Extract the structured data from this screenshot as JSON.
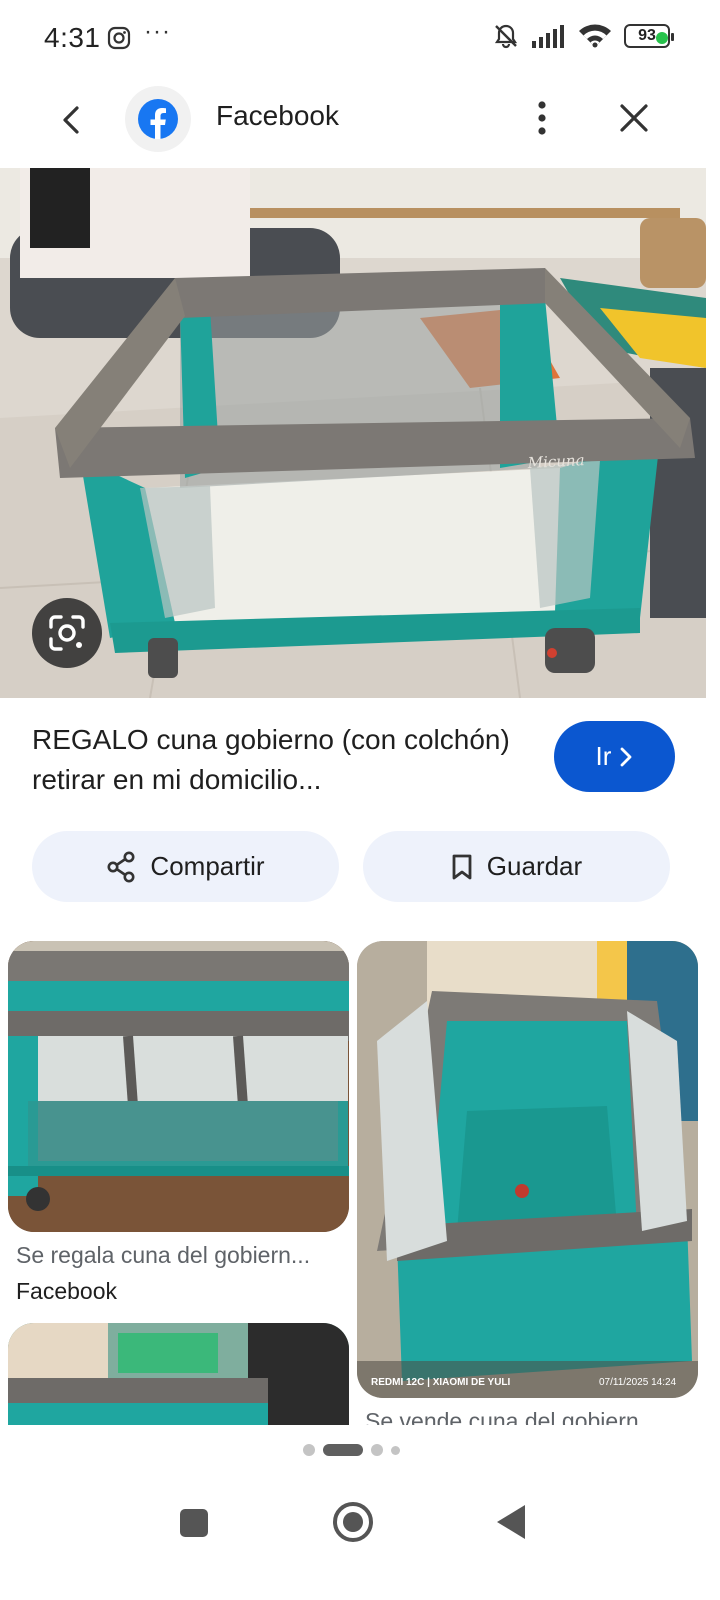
{
  "status_bar": {
    "time": "4:31",
    "battery": "93",
    "icons": [
      "instagram-icon",
      "more-dots-icon",
      "mute-icon",
      "signal-icon",
      "wifi-icon",
      "battery-icon"
    ]
  },
  "header": {
    "title": "Facebook",
    "back_icon": "chevron-left-icon",
    "more_icon": "more-vert-icon",
    "close_icon": "close-icon"
  },
  "result": {
    "title": "REGALO cuna gobierno (con colchón) retirar en mi domicilio...",
    "go_label": "Ir",
    "go_icon": "chevron-right-icon",
    "brand_accent": "#0b57d0"
  },
  "actions": {
    "share_label": "Compartir",
    "save_label": "Guardar"
  },
  "related": [
    {
      "caption": "Se regala cuna del gobiern...",
      "source": "Facebook"
    },
    {
      "caption": "Se vende cuna del gobiern",
      "watermark_left": "REDMI 12C | XIAOMI DE YULI",
      "watermark_right": "07/11/2025 14:24"
    },
    {
      "caption": ""
    }
  ],
  "main_image": {
    "brand_text": "Micuna"
  },
  "pager": {
    "count": 4,
    "active": 1
  }
}
